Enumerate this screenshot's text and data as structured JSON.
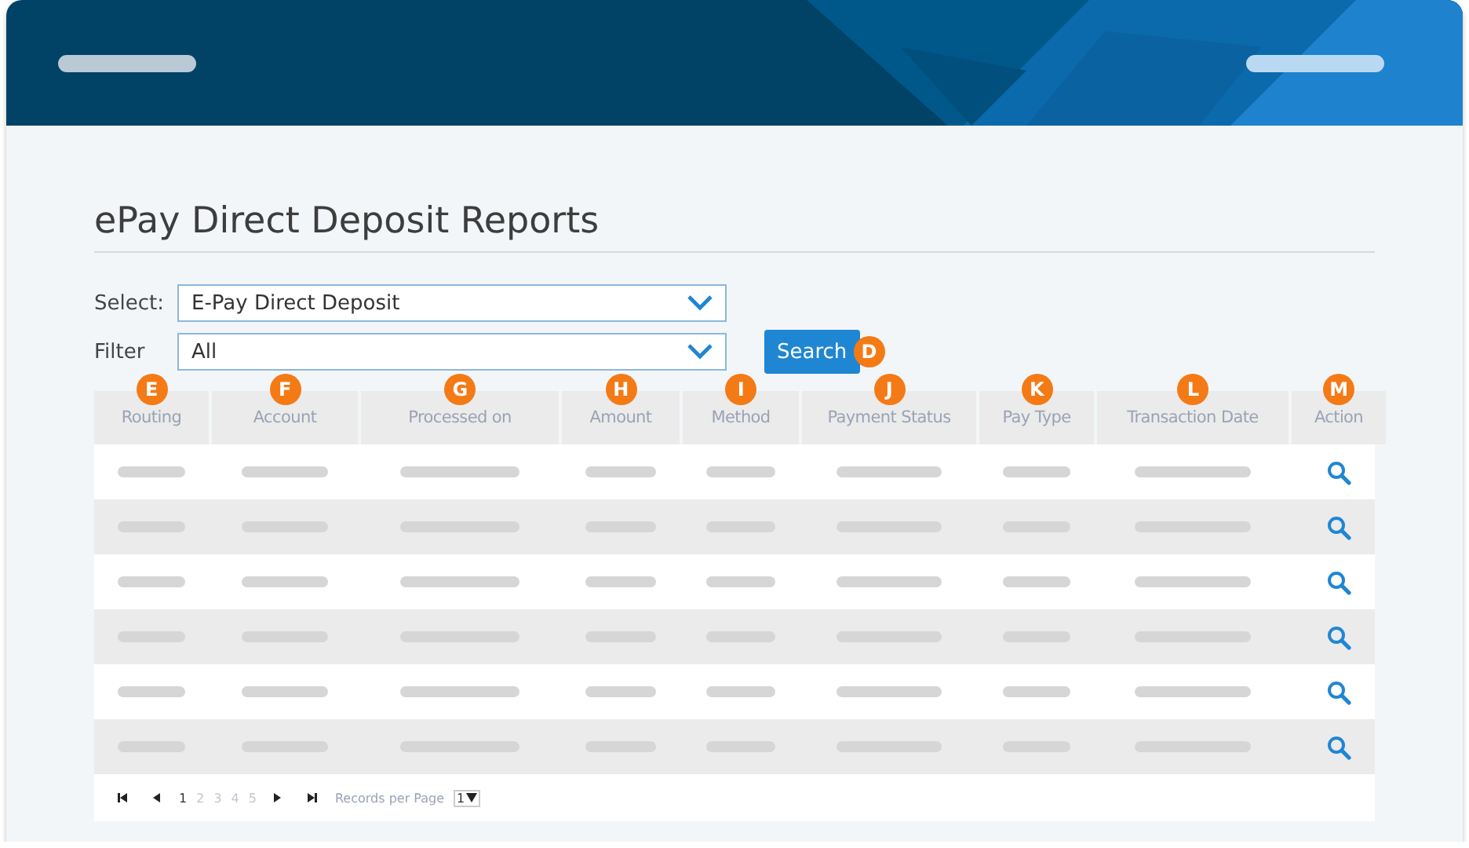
{
  "title": "ePay Direct Deposit Reports",
  "form": {
    "select": {
      "label": "Select:",
      "value": "E-Pay Direct Deposit"
    },
    "filter": {
      "label": "Filter",
      "value": "All"
    },
    "search_button": {
      "label": "Search",
      "badge": "D"
    }
  },
  "table": {
    "columns": [
      {
        "label": "Routing",
        "badge": "E"
      },
      {
        "label": "Account",
        "badge": "F"
      },
      {
        "label": "Processed on",
        "badge": "G"
      },
      {
        "label": "Amount",
        "badge": "H"
      },
      {
        "label": "Method",
        "badge": "I"
      },
      {
        "label": "Payment Status",
        "badge": "J"
      },
      {
        "label": "Pay Type",
        "badge": "K"
      },
      {
        "label": "Transaction Date",
        "badge": "L"
      },
      {
        "label": "Action",
        "badge": "M"
      }
    ],
    "rows": [
      {
        "kind": "placeholder"
      },
      {
        "kind": "placeholder"
      },
      {
        "kind": "placeholder"
      },
      {
        "kind": "placeholder"
      },
      {
        "kind": "placeholder"
      },
      {
        "kind": "placeholder"
      }
    ]
  },
  "pagination": {
    "pages": [
      {
        "label": "1",
        "selected": true
      },
      {
        "label": "2",
        "selected": false
      },
      {
        "label": "3",
        "selected": false
      },
      {
        "label": "4",
        "selected": false
      },
      {
        "label": "5",
        "selected": false
      }
    ],
    "records_label": "Records per Page",
    "per_page": "1"
  }
}
